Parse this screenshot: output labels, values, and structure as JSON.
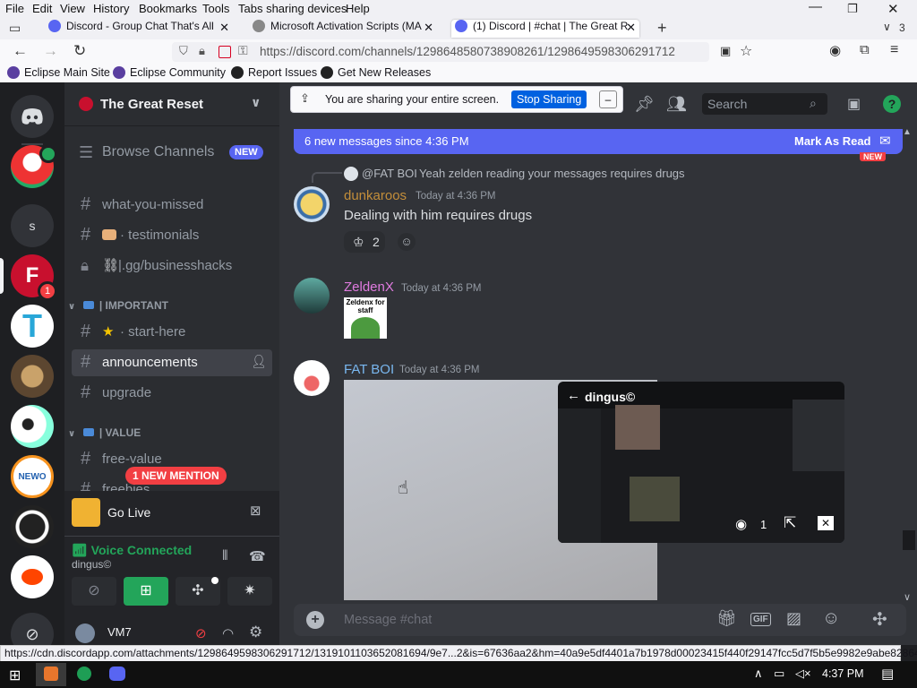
{
  "menubar": {
    "items": [
      "File",
      "Edit",
      "View",
      "History",
      "Bookmarks",
      "Tools",
      "Tabs sharing devices",
      "Help"
    ]
  },
  "tabs": [
    {
      "title": "Discord - Group Chat That's All"
    },
    {
      "title": "Microsoft Activation Scripts (MA"
    },
    {
      "title": "(1) Discord | #chat | The Great R"
    }
  ],
  "tab_overflow_count": "3",
  "urlbar": {
    "url": "https://discord.com/channels/1298648580738908261/1298649598306291712"
  },
  "bookmarks": [
    "Eclipse Main Site",
    "Eclipse Community",
    "Report Issues",
    "Get New Releases"
  ],
  "screenshare_banner": {
    "text": "You are sharing your entire screen.",
    "stop_label": "Stop Sharing",
    "hide_label": "–"
  },
  "server": {
    "name": "The Great Reset",
    "browse_label": "Browse Channels",
    "new_badge": "NEW",
    "mention_pill": "1 NEW MENTION",
    "guild_badge": "1",
    "guild_letter": "s"
  },
  "channels": [
    {
      "name": "what-you-missed"
    },
    {
      "name": "· testimonials"
    },
    {
      "name": "|.gg/businesshacks"
    },
    {
      "category": "| IMPORTANT"
    },
    {
      "name": "· start-here"
    },
    {
      "name": "announcements"
    },
    {
      "name": "upgrade"
    },
    {
      "category": "| VALUE"
    },
    {
      "name": "free-value"
    },
    {
      "name": "freebies"
    }
  ],
  "golive": {
    "label": "Go Live"
  },
  "voice": {
    "status": "Voice Connected",
    "channel": "dingus©"
  },
  "user": {
    "name": "VM7"
  },
  "chat": {
    "new_messages_bar": "6 new messages since 4:36 PM",
    "mark_read": "Mark As Read",
    "new_label": "NEW",
    "search_placeholder": "Search",
    "reply_preview": {
      "user": "@FAT BOI",
      "text": "Yeah zelden reading your messages requires drugs"
    },
    "messages": [
      {
        "user": "dunkaroos",
        "time": "Today at 4:36 PM",
        "text": "Dealing with him requires drugs",
        "reaction_count": "2",
        "color": "#c38e3a"
      },
      {
        "user": "ZeldenX",
        "time": "Today at 4:36 PM",
        "sticker_text": "Zeldenx for staff",
        "color": "#e07be0"
      },
      {
        "user": "FAT BOI",
        "time": "Today at 4:36 PM",
        "color": "#79b7ef"
      }
    ],
    "message_placeholder": "Message #chat"
  },
  "stream_popout": {
    "title": "dingus©",
    "viewers": "1"
  },
  "statusbar": {
    "url": "https://cdn.discordapp.com/attachments/1298649598306291712/1319101103652081694/9e7...2&is=67636aa2&hm=40a9e5df4401a7b1978d00023415f440f29147fcc5d7f5b5e9982e9abe82864a&"
  },
  "taskbar": {
    "clock": "4:37 PM"
  },
  "colors": {
    "blurple": "#5865f2",
    "green": "#23a55a",
    "red": "#f23f43"
  }
}
